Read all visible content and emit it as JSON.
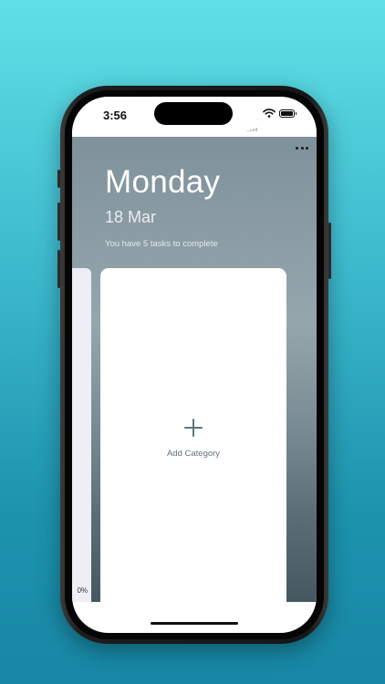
{
  "status_bar": {
    "time": "3:56",
    "icons": [
      "cellular-signal-icon",
      "wifi-icon",
      "battery-icon"
    ]
  },
  "header": {
    "more_icon": "ellipsis-icon",
    "day": "Monday",
    "date": "18 Mar",
    "summary": "You have 5 tasks to complete"
  },
  "cards": {
    "previous": {
      "progress_text": "0%"
    },
    "add": {
      "icon": "plus-icon",
      "label": "Add Category"
    }
  },
  "colors": {
    "accent": "#5d747d",
    "background_top": "#5fe0e6",
    "background_bottom": "#1787a5"
  }
}
